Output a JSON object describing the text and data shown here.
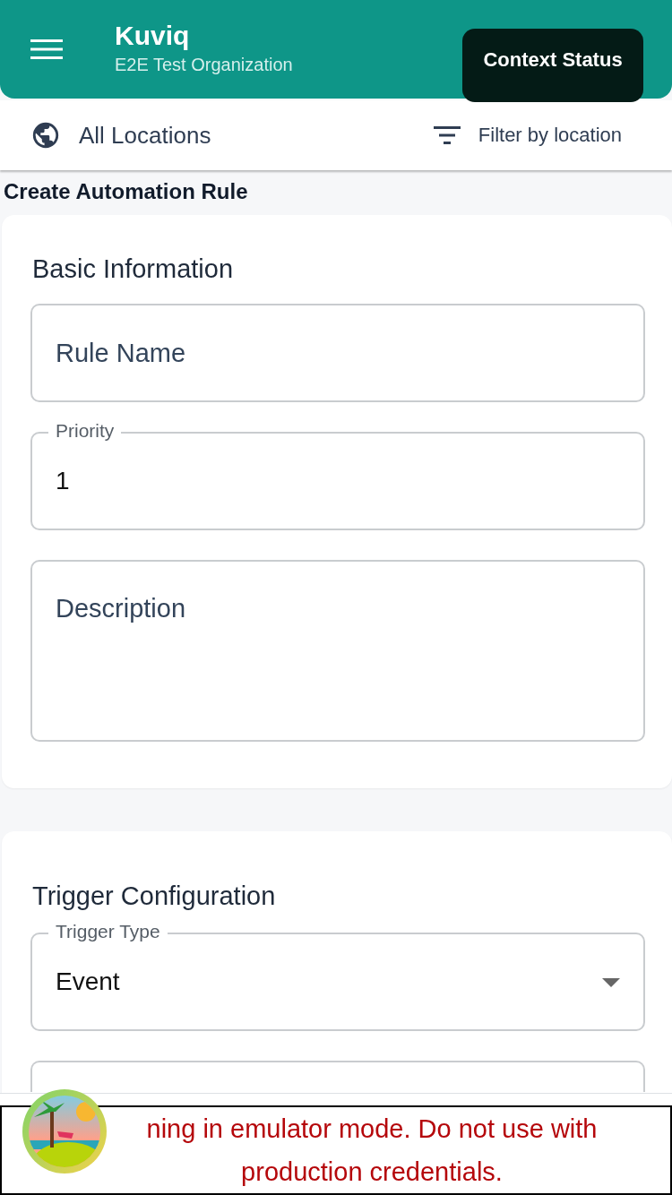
{
  "app_bar": {
    "title": "Kuviq",
    "subtitle": "E2E Test Organization",
    "tooltip": "Context Status"
  },
  "location_bar": {
    "location": "All Locations",
    "filter": "Filter by location"
  },
  "page_title": "Create Automation Rule",
  "sections": [
    {
      "title": "Basic Information",
      "fields": [
        {
          "kind": "input",
          "placeholder": "Rule Name"
        },
        {
          "kind": "input",
          "label": "Priority",
          "value": "1"
        },
        {
          "kind": "textarea",
          "placeholder": "Description"
        }
      ]
    },
    {
      "title": "Trigger Configuration",
      "fields": [
        {
          "kind": "select",
          "label": "Trigger Type",
          "value": "Event"
        },
        {
          "kind": "input"
        }
      ]
    }
  ],
  "banner": "ning in emulator mode. Do not use with production credentials."
}
